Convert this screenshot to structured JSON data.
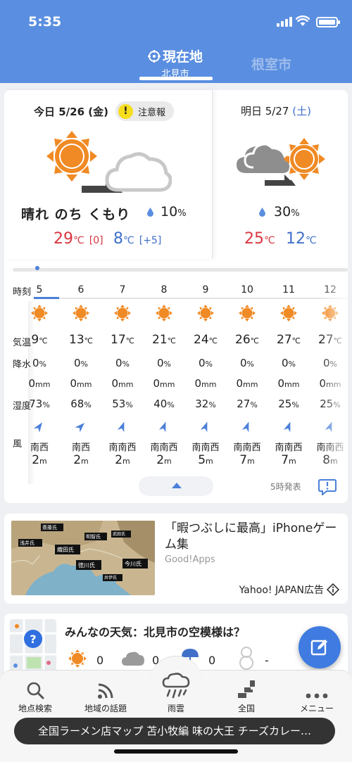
{
  "status": {
    "time": "5:35"
  },
  "tabs": {
    "current_label": "現在地",
    "current_sub": "北見市",
    "other_label": "根室市"
  },
  "today": {
    "date": "今日 5/26 (金)",
    "badge": "注意報",
    "badge_icon": "!",
    "weather": "晴れ のち くもり",
    "precip_value": "10",
    "precip_unit": "%",
    "high_value": "29",
    "high_unit": "℃",
    "high_diff": "[0]",
    "low_value": "8",
    "low_unit": "℃",
    "low_diff": "[+5]"
  },
  "tomorrow": {
    "date_prefix": "明日 5/27",
    "date_day": "(土)",
    "precip_value": "30",
    "precip_unit": "%",
    "high_value": "25",
    "high_unit": "℃",
    "low_value": "12",
    "low_unit": "℃"
  },
  "hourly": {
    "row_labels": {
      "time": "時刻",
      "temp": "気温",
      "precip": "降水",
      "humidity": "湿度",
      "wind": "風"
    },
    "columns": [
      {
        "hour": "5",
        "temp": "9",
        "prob": "0",
        "amount": "0",
        "humidity": "73",
        "wind_dir": "南西",
        "wind_speed": "2"
      },
      {
        "hour": "6",
        "temp": "13",
        "prob": "0",
        "amount": "0",
        "humidity": "68",
        "wind_dir": "南西",
        "wind_speed": "2"
      },
      {
        "hour": "7",
        "temp": "17",
        "prob": "0",
        "amount": "0",
        "humidity": "53",
        "wind_dir": "南南西",
        "wind_speed": "2"
      },
      {
        "hour": "8",
        "temp": "21",
        "prob": "0",
        "amount": "0",
        "humidity": "40",
        "wind_dir": "南南西",
        "wind_speed": "2"
      },
      {
        "hour": "9",
        "temp": "24",
        "prob": "0",
        "amount": "0",
        "humidity": "32",
        "wind_dir": "南南西",
        "wind_speed": "5"
      },
      {
        "hour": "10",
        "temp": "26",
        "prob": "0",
        "amount": "0",
        "humidity": "27",
        "wind_dir": "南南西",
        "wind_speed": "7"
      },
      {
        "hour": "11",
        "temp": "27",
        "prob": "0",
        "amount": "0",
        "humidity": "25",
        "wind_dir": "南南西",
        "wind_speed": "7"
      },
      {
        "hour": "12",
        "temp": "27",
        "prob": "0",
        "amount": "0",
        "humidity": "25",
        "wind_dir": "南南西",
        "wind_speed": "8"
      }
    ],
    "units": {
      "temp": "℃",
      "prob": "%",
      "amount": "mm",
      "humidity": "%",
      "wind": "m"
    },
    "issued": "5時発表"
  },
  "ad": {
    "title": "「暇つぶしに最高」iPhoneゲーム集",
    "source": "Good!Apps",
    "label": "Yahoo! JAPAN広告",
    "map_labels": [
      "斎藤氏",
      "浅井氏",
      "織田氏",
      "明智氏",
      "武田氏",
      "徳川氏",
      "今川氏",
      "井伊氏"
    ]
  },
  "minna": {
    "title": "みんなの天気：北見市の空模様は？",
    "counts": [
      "0",
      "0",
      "0",
      "-"
    ]
  },
  "nav": {
    "items": [
      {
        "label": "地点検索",
        "icon": "search-icon"
      },
      {
        "label": "地域の話題",
        "icon": "rss-icon"
      },
      {
        "label": "雨雲",
        "icon": "rain-cloud-icon"
      },
      {
        "label": "全国",
        "icon": "map-icon"
      },
      {
        "label": "メニュー",
        "icon": "more-icon"
      }
    ]
  },
  "ticker": "全国ラーメン店マップ 苫小牧編 味の大王 チーズカレー…",
  "colors": {
    "header": "#5a8ee0",
    "accent": "#4a80d8",
    "high": "#d9363e",
    "low": "#3f6fc9",
    "sun": "#f08a24"
  }
}
